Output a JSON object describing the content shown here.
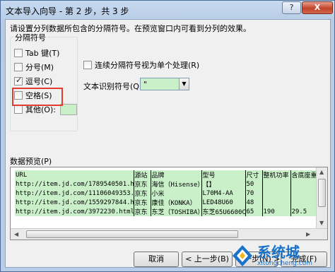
{
  "window": {
    "title": "文本导入向导 - 第 2 步，共 3 步",
    "help": "?",
    "close": "X"
  },
  "description": "请设置分列数据所包含的分隔符号。在预览窗口内可看到分列的效果。",
  "delimiters": {
    "group_title": "分隔符号",
    "tab": {
      "label": "Tab 键(T)",
      "checked": false
    },
    "semicolon": {
      "label": "分号(M)",
      "checked": false
    },
    "comma": {
      "label": "逗号(C)",
      "checked": true
    },
    "space": {
      "label": "空格(S)",
      "checked": false
    },
    "other": {
      "label": "其他(O):",
      "checked": false,
      "value": ""
    }
  },
  "consecutive": {
    "label": "连续分隔符号视为单个处理(R)",
    "checked": false
  },
  "text_qualifier": {
    "label": "文本识别符号(Q):",
    "value": "\""
  },
  "preview": {
    "label": "数据预览(P)",
    "rows": [
      [
        "URL",
        "源站",
        "品牌",
        "型号",
        "尺寸",
        "整机功率",
        "含底座重"
      ],
      [
        "http://item.jd.com/1789540501.html",
        "京东",
        "海信（Hisense）",
        "【】",
        "50",
        "",
        ""
      ],
      [
        "http://item.jd.com/11106049353.html",
        "京东",
        "小米",
        "L70M4-AA",
        "70",
        "",
        ""
      ],
      [
        "http://item.jd.com/1559297844.html",
        "京东",
        "康佳（KONKA）",
        "LED48U60",
        "48",
        "",
        ""
      ],
      [
        "http://item.jd.com/3972230.html",
        "京东",
        "东芝（TOSHIBA）",
        "东芝65U6600C",
        "65",
        "190",
        "29.5"
      ]
    ]
  },
  "buttons": {
    "cancel": "取消",
    "back": "< 上一步(B)",
    "next": "下一步(N) >",
    "finish": "完成(F)"
  },
  "watermark": {
    "big": "系统城",
    "small": "xitongcheng.com"
  }
}
